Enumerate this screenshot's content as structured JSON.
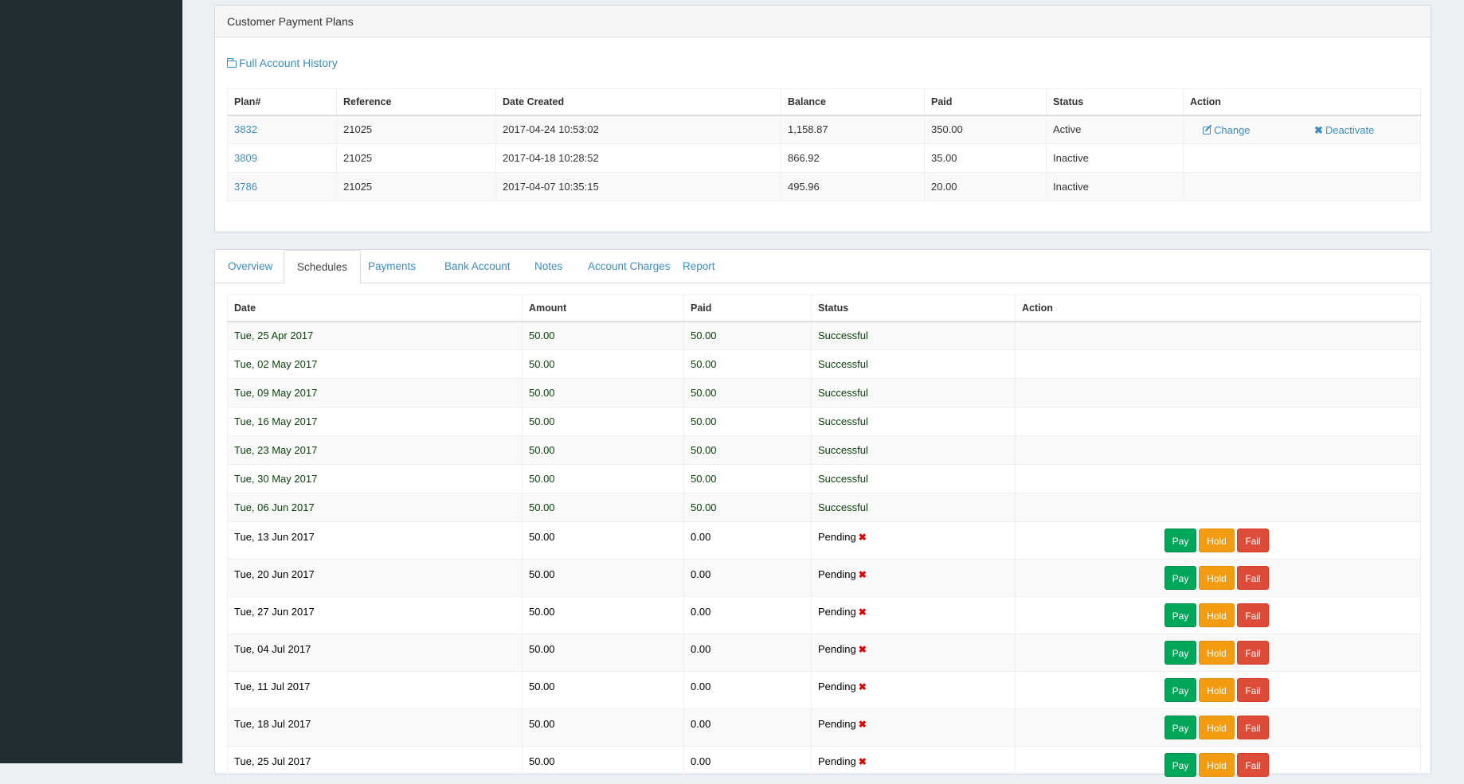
{
  "plans_box": {
    "title": "Customer Payment Plans",
    "history_link": "Full Account History",
    "columns": [
      "Plan#",
      "Reference",
      "Date Created",
      "Balance",
      "Paid",
      "Status",
      "Action"
    ],
    "rows": [
      {
        "plan": "3832",
        "reference": "21025",
        "date_created": "2017-04-24 10:53:02",
        "balance": "1,158.87",
        "paid": "350.00",
        "status": "Active",
        "change": "Change",
        "deactivate": "Deactivate"
      },
      {
        "plan": "3809",
        "reference": "21025",
        "date_created": "2017-04-18 10:28:52",
        "balance": "866.92",
        "paid": "35.00",
        "status": "Inactive"
      },
      {
        "plan": "3786",
        "reference": "21025",
        "date_created": "2017-04-07 10:35:15",
        "balance": "495.96",
        "paid": "20.00",
        "status": "Inactive"
      }
    ]
  },
  "tabs": [
    "Overview",
    "Schedules",
    "Payments",
    "Bank Account",
    "Notes",
    "Account Charges",
    "Report"
  ],
  "active_tab": "Schedules",
  "schedule": {
    "columns": [
      "Date",
      "Amount",
      "Paid",
      "Status",
      "Action"
    ],
    "buttons": {
      "pay": "Pay",
      "hold": "Hold",
      "fail": "Fail"
    },
    "rows": [
      {
        "date": "Tue, 25 Apr 2017",
        "amount": "50.00",
        "paid": "50.00",
        "status": "Successful"
      },
      {
        "date": "Tue, 02 May 2017",
        "amount": "50.00",
        "paid": "50.00",
        "status": "Successful"
      },
      {
        "date": "Tue, 09 May 2017",
        "amount": "50.00",
        "paid": "50.00",
        "status": "Successful"
      },
      {
        "date": "Tue, 16 May 2017",
        "amount": "50.00",
        "paid": "50.00",
        "status": "Successful"
      },
      {
        "date": "Tue, 23 May 2017",
        "amount": "50.00",
        "paid": "50.00",
        "status": "Successful"
      },
      {
        "date": "Tue, 30 May 2017",
        "amount": "50.00",
        "paid": "50.00",
        "status": "Successful"
      },
      {
        "date": "Tue, 06 Jun 2017",
        "amount": "50.00",
        "paid": "50.00",
        "status": "Successful"
      },
      {
        "date": "Tue, 13 Jun 2017",
        "amount": "50.00",
        "paid": "0.00",
        "status": "Pending"
      },
      {
        "date": "Tue, 20 Jun 2017",
        "amount": "50.00",
        "paid": "0.00",
        "status": "Pending"
      },
      {
        "date": "Tue, 27 Jun 2017",
        "amount": "50.00",
        "paid": "0.00",
        "status": "Pending"
      },
      {
        "date": "Tue, 04 Jul 2017",
        "amount": "50.00",
        "paid": "0.00",
        "status": "Pending"
      },
      {
        "date": "Tue, 11 Jul 2017",
        "amount": "50.00",
        "paid": "0.00",
        "status": "Pending"
      },
      {
        "date": "Tue, 18 Jul 2017",
        "amount": "50.00",
        "paid": "0.00",
        "status": "Pending"
      },
      {
        "date": "Tue, 25 Jul 2017",
        "amount": "50.00",
        "paid": "0.00",
        "status": "Pending"
      }
    ]
  }
}
